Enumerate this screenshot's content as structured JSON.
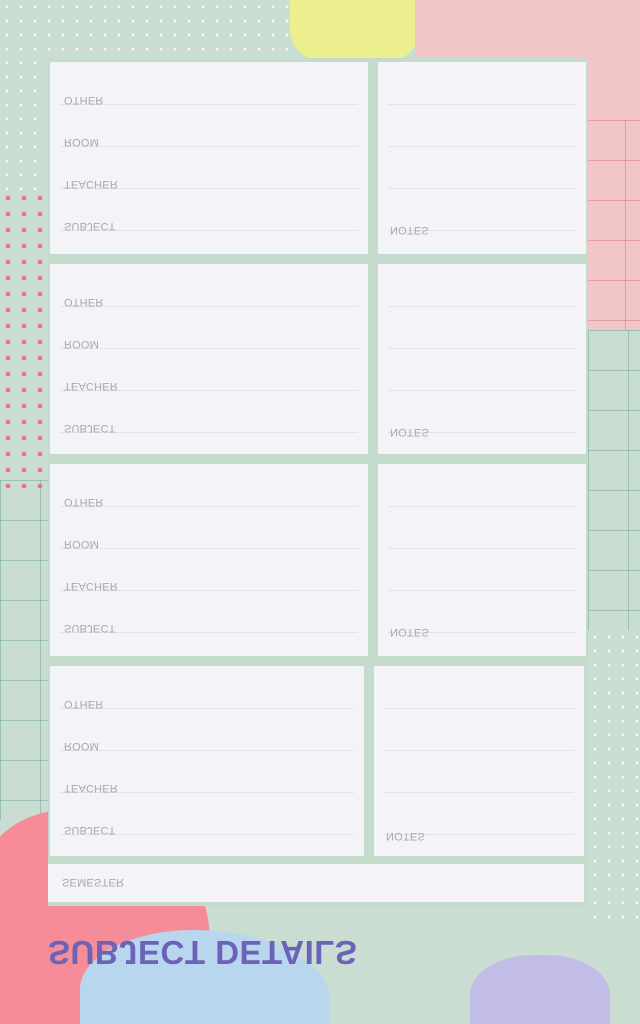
{
  "title": "SUBJECT DETAILS",
  "semester_label": "SEMESTER",
  "notes_label": "NOTES",
  "field_labels": [
    "OTHER",
    "ROOM",
    "TEACHER",
    "SUBJECT"
  ],
  "blocks": [
    {
      "fields": [
        "OTHER",
        "ROOM",
        "TEACHER",
        "SUBJECT"
      ],
      "notes": "NOTES"
    },
    {
      "fields": [
        "OTHER",
        "ROOM",
        "TEACHER",
        "SUBJECT"
      ],
      "notes": "NOTES"
    },
    {
      "fields": [
        "OTHER",
        "ROOM",
        "TEACHER",
        "SUBJECT"
      ],
      "notes": "NOTES"
    },
    {
      "fields": [
        "OTHER",
        "ROOM",
        "TEACHER",
        "SUBJECT"
      ],
      "notes": "NOTES"
    }
  ],
  "colors": {
    "background_mint": "#c9ddd2",
    "pink_blob": "#f7848f",
    "coral_blob": "#f58c97",
    "blue_blob": "#b8d6ee",
    "lavender_blob": "#c2bde6",
    "yellow_blob": "#ecef8e",
    "blush_blob": "#f0c6c8",
    "title_purple": "#6c63b8"
  }
}
